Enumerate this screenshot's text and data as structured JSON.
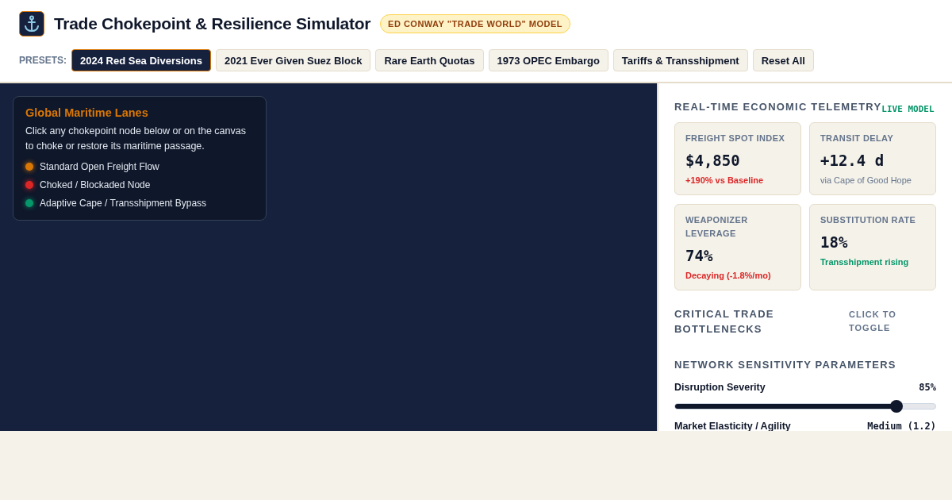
{
  "header": {
    "title": "Trade Chokepoint & Resilience Simulator",
    "badge": "ED CONWAY \"TRADE WORLD\" MODEL"
  },
  "presets": {
    "label": "PRESETS:",
    "items": [
      {
        "label": "2024 Red Sea Diversions",
        "selected": true
      },
      {
        "label": "2021 Ever Given Suez Block",
        "selected": false
      },
      {
        "label": "Rare Earth Quotas",
        "selected": false
      },
      {
        "label": "1973 OPEC Embargo",
        "selected": false
      },
      {
        "label": "Tariffs & Transshipment",
        "selected": false
      },
      {
        "label": "Reset All",
        "selected": false
      }
    ]
  },
  "legend": {
    "title": "Global Maritime Lanes",
    "text": "Click any chokepoint node below or on the canvas to choke or restore its maritime passage.",
    "items": [
      {
        "label": "Standard Open Freight Flow",
        "color": "#d97706"
      },
      {
        "label": "Choked / Blockaded Node",
        "color": "#dc2626"
      },
      {
        "label": "Adaptive Cape / Transshipment Bypass",
        "color": "#059669"
      }
    ]
  },
  "telemetry": {
    "title": "REAL-TIME ECONOMIC TELEMETRY",
    "tag": "LIVE MODEL",
    "cards": [
      {
        "label": "FREIGHT SPOT INDEX",
        "value": "$4,850",
        "note": "+190% vs Baseline",
        "color": "#dc2626"
      },
      {
        "label": "TRANSIT DELAY",
        "value": "+12.4 d",
        "note": "via Cape of Good Hope",
        "color": "#64748b"
      },
      {
        "label": "WEAPONIZER LEVERAGE",
        "value": "74%",
        "note": "Decaying (-1.8%/mo)",
        "color": "#dc2626"
      },
      {
        "label": "SUBSTITUTION RATE",
        "value": "18%",
        "note": "Transshipment rising",
        "color": "#059669"
      }
    ]
  },
  "bottlenecks": {
    "title": "CRITICAL TRADE BOTTLENECKS",
    "hint": "CLICK TO TOGGLE"
  },
  "parameters": {
    "title": "NETWORK SENSITIVITY PARAMETERS",
    "sliders": [
      {
        "label": "Disruption Severity",
        "reading": "85%",
        "level": 0.85
      },
      {
        "label": "Market Elasticity / Agility",
        "reading": "Medium (1.2)"
      }
    ]
  }
}
